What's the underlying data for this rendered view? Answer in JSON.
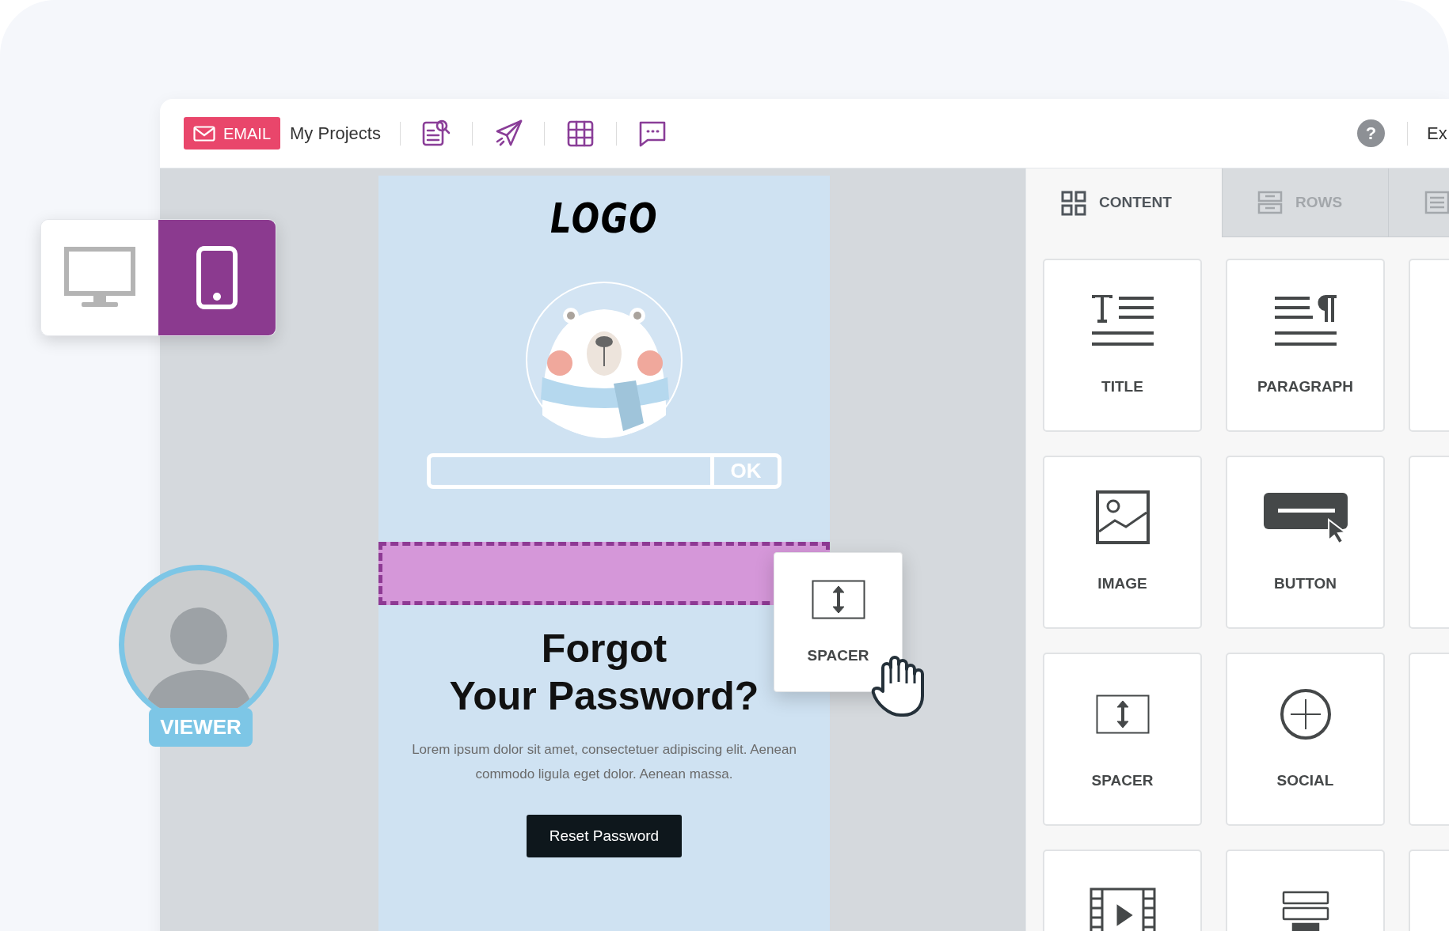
{
  "header": {
    "badge": "EMAIL",
    "project_link": "My Projects",
    "help": "?",
    "cut_label": "Ex"
  },
  "device_toggle": [
    {
      "kind": "desktop",
      "selected": false
    },
    {
      "kind": "mobile",
      "selected": true
    }
  ],
  "viewer": {
    "role": "VIEWER"
  },
  "email": {
    "logo": "LOGO",
    "input_button": "OK",
    "heading": "Forgot\nYour Password?",
    "body": "Lorem ipsum dolor sit amet, consectetuer adipiscing elit. Aenean commodo ligula eget dolor. Aenean massa.",
    "button": "Reset Password"
  },
  "drag_tile": {
    "label": "SPACER"
  },
  "panel": {
    "tabs": [
      {
        "label": "CONTENT",
        "kind": "content",
        "selected": true
      },
      {
        "label": "ROWS",
        "kind": "rows",
        "selected": false
      },
      {
        "kind": "settings",
        "selected": false
      }
    ],
    "tiles": [
      {
        "kind": "title",
        "label": "TITLE"
      },
      {
        "kind": "paragraph",
        "label": "PARAGRAPH"
      },
      {
        "kind": "empty"
      },
      {
        "kind": "image",
        "label": "IMAGE"
      },
      {
        "kind": "button",
        "label": "BUTTON"
      },
      {
        "kind": "empty"
      },
      {
        "kind": "spacer",
        "label": "SPACER"
      },
      {
        "kind": "social",
        "label": "SOCIAL"
      },
      {
        "kind": "empty"
      },
      {
        "kind": "video"
      },
      {
        "kind": "divider"
      },
      {
        "kind": "empty"
      }
    ]
  }
}
